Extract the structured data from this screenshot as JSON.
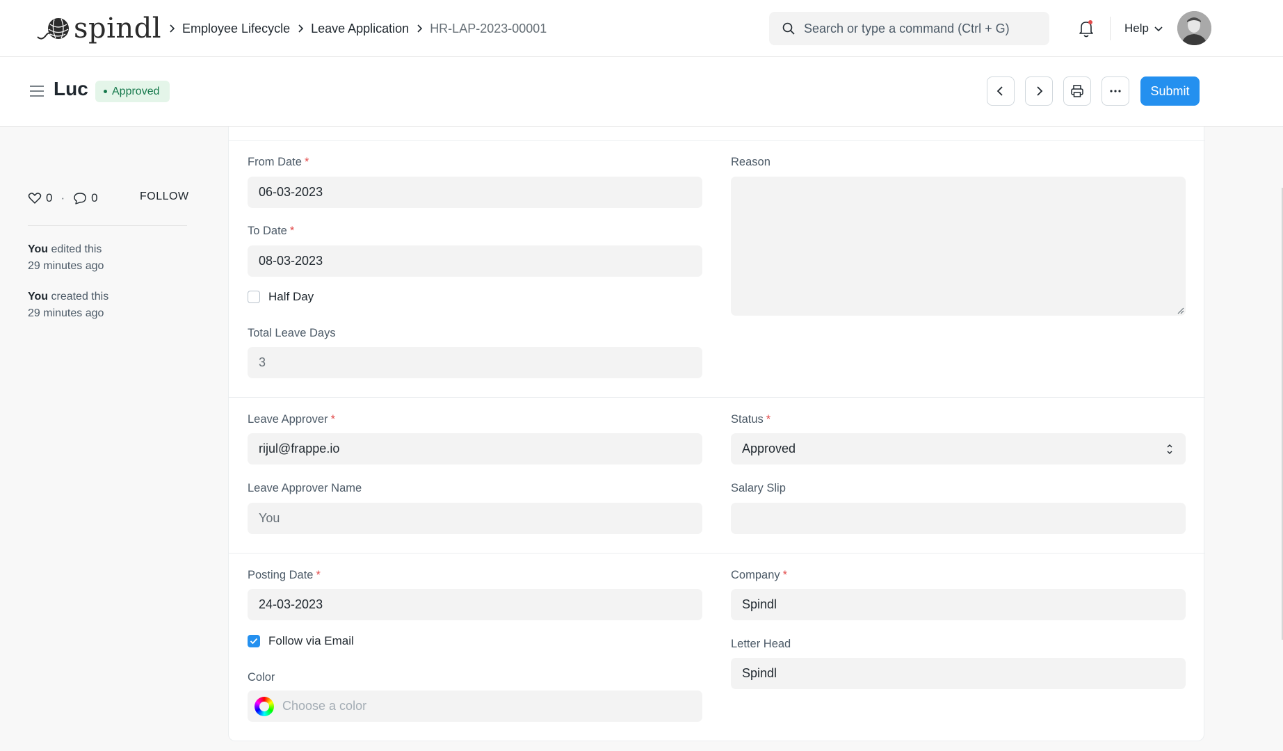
{
  "navbar": {
    "logo_text": "spindl",
    "breadcrumbs": [
      "Employee Lifecycle",
      "Leave Application",
      "HR-LAP-2023-00001"
    ],
    "search_placeholder": "Search or type a command (Ctrl + G)",
    "help_label": "Help"
  },
  "page": {
    "title": "Luc",
    "status_badge": "Approved",
    "status_color": "#16794c",
    "submit_label": "Submit",
    "accent_color": "#2490ef"
  },
  "sidebar": {
    "likes_count": "0",
    "separator": "·",
    "comments_count": "0",
    "follow_label": "FOLLOW",
    "activity": [
      {
        "who": "You",
        "what": "edited this",
        "when": "29 minutes ago"
      },
      {
        "who": "You",
        "what": "created this",
        "when": "29 minutes ago"
      }
    ]
  },
  "form": {
    "from_date": {
      "label": "From Date",
      "value": "06-03-2023"
    },
    "to_date": {
      "label": "To Date",
      "value": "08-03-2023"
    },
    "half_day": {
      "label": "Half Day",
      "checked": false
    },
    "total_leave_days": {
      "label": "Total Leave Days",
      "value": "3"
    },
    "reason": {
      "label": "Reason",
      "value": ""
    },
    "leave_approver": {
      "label": "Leave Approver",
      "value": "rijul@frappe.io"
    },
    "leave_approver_name": {
      "label": "Leave Approver Name",
      "value": "You"
    },
    "status": {
      "label": "Status",
      "value": "Approved"
    },
    "salary_slip": {
      "label": "Salary Slip",
      "value": ""
    },
    "posting_date": {
      "label": "Posting Date",
      "value": "24-03-2023"
    },
    "follow_via_email": {
      "label": "Follow via Email",
      "checked": true
    },
    "color": {
      "label": "Color",
      "placeholder": "Choose a color"
    },
    "company": {
      "label": "Company",
      "value": "Spindl"
    },
    "letter_head": {
      "label": "Letter Head",
      "value": "Spindl"
    }
  }
}
